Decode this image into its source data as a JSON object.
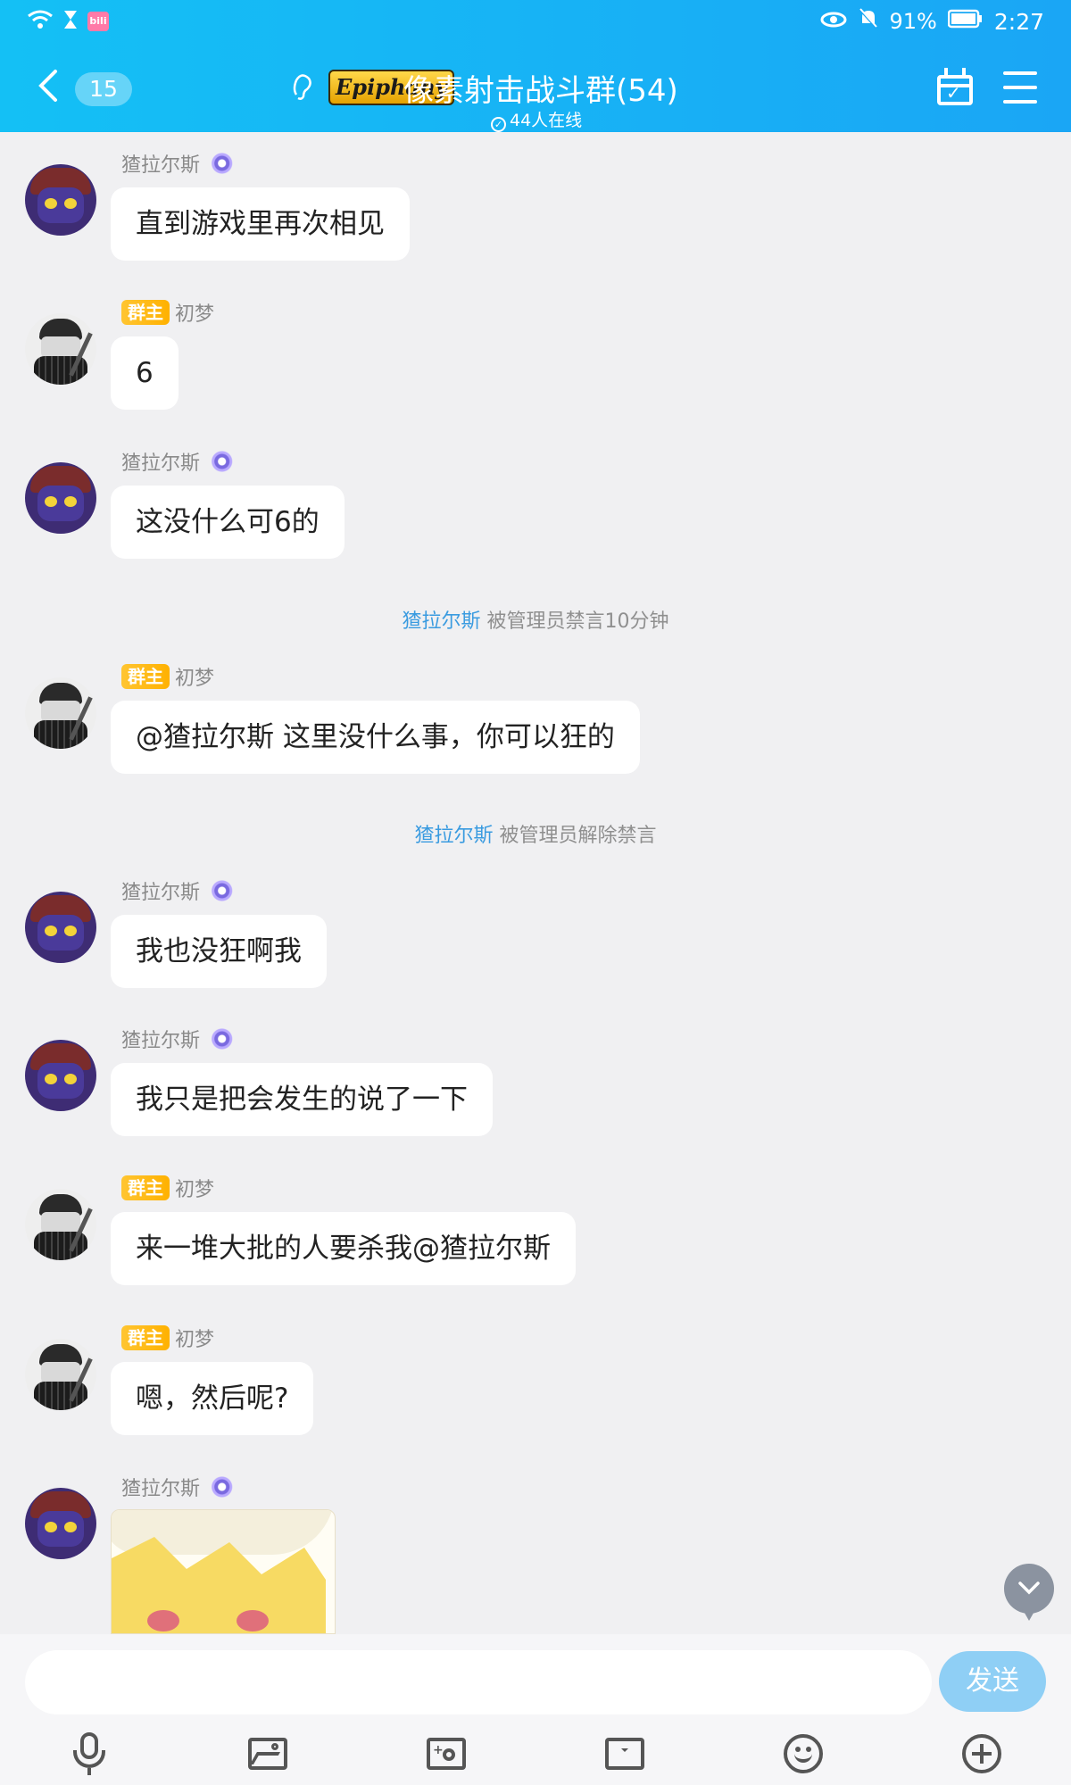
{
  "status_bar": {
    "battery": "91%",
    "time": "2:27",
    "icons": [
      "wifi-icon",
      "hourglass-icon",
      "bilibili-icon",
      "eye-icon",
      "mute-bell-icon",
      "battery-icon"
    ]
  },
  "header": {
    "unread_count": "15",
    "logo_text": "Epiphany",
    "group_title": "像素射击战斗群(54)",
    "online_text": "44人在线",
    "colors": {
      "gradient_start": "#14c0f5",
      "gradient_end": "#1aa6f5"
    }
  },
  "labels": {
    "owner_tag": "群主"
  },
  "messages": [
    {
      "sender": "猹拉尔斯",
      "role": "",
      "avatar": "cat-avatar",
      "text": "直到游戏里再次相见"
    },
    {
      "sender": "初梦",
      "role": "群主",
      "avatar": "ninja-avatar",
      "text": "6"
    },
    {
      "sender": "猹拉尔斯",
      "role": "",
      "avatar": "cat-avatar",
      "text": "这没什么可6的"
    },
    {
      "system": true,
      "who": "猹拉尔斯",
      "text": " 被管理员禁言10分钟"
    },
    {
      "sender": "初梦",
      "role": "群主",
      "avatar": "ninja-avatar",
      "text": "@猹拉尔斯 这里没什么事，你可以狂的"
    },
    {
      "system": true,
      "who": "猹拉尔斯",
      "text": " 被管理员解除禁言"
    },
    {
      "sender": "猹拉尔斯",
      "role": "",
      "avatar": "cat-avatar",
      "text": "我也没狂啊我"
    },
    {
      "sender": "猹拉尔斯",
      "role": "",
      "avatar": "cat-avatar",
      "text": "我只是把会发生的说了一下"
    },
    {
      "sender": "初梦",
      "role": "群主",
      "avatar": "ninja-avatar",
      "text": "来一堆大批的人要杀我@猹拉尔斯"
    },
    {
      "sender": "初梦",
      "role": "群主",
      "avatar": "ninja-avatar",
      "text": "嗯，然后呢?"
    },
    {
      "sender": "猹拉尔斯",
      "role": "",
      "avatar": "cat-avatar",
      "text": "",
      "image": "anime-sticker-image"
    }
  ],
  "input": {
    "placeholder": "",
    "value": "",
    "send_label": "发送",
    "send_color": "#8fcff5"
  },
  "toolbar": [
    "mic-icon",
    "picture-icon",
    "camera-icon",
    "red-packet-icon",
    "emoji-icon",
    "plus-icon"
  ]
}
